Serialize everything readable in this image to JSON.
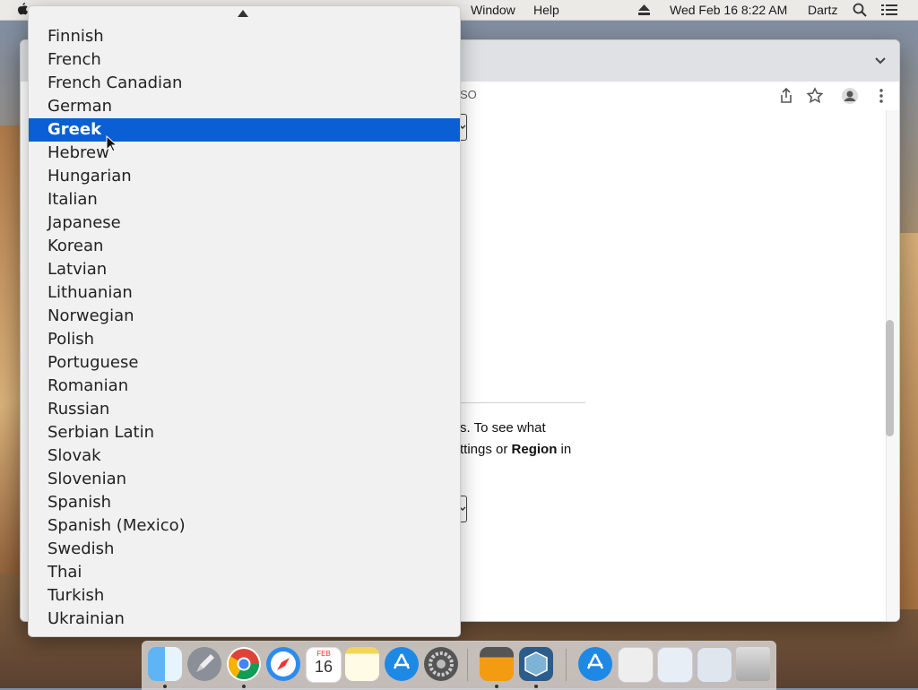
{
  "menubar": {
    "items": [
      "Window",
      "Help"
    ],
    "clock": "Wed Feb 16  8:22 AM",
    "user": "Dartz"
  },
  "browser": {
    "omnibox_fragment": "SO",
    "page_text": {
      "line1": "s. To see what",
      "line2_pre": "ttings or ",
      "line2_bold": "Region",
      "line2_post": " in"
    }
  },
  "dropdown": {
    "options": [
      "Finnish",
      "French",
      "French Canadian",
      "German",
      "Greek",
      "Hebrew",
      "Hungarian",
      "Italian",
      "Japanese",
      "Korean",
      "Latvian",
      "Lithuanian",
      "Norwegian",
      "Polish",
      "Portuguese",
      "Romanian",
      "Russian",
      "Serbian Latin",
      "Slovak",
      "Slovenian",
      "Spanish",
      "Spanish (Mexico)",
      "Swedish",
      "Thai",
      "Turkish",
      "Ukrainian"
    ],
    "selected": "Greek"
  },
  "dock": {
    "calendar_month": "FEB",
    "calendar_day": "16",
    "apps": [
      "finder-icon",
      "launchpad-icon",
      "chrome-icon",
      "safari-icon",
      "calendar-icon",
      "notes-icon",
      "app-store-icon",
      "system-preferences-icon",
      "calculator-icon",
      "virtualbox-icon",
      "app-store-folder-icon",
      "document-icon",
      "downloads-folder-icon",
      "screenshot-icon",
      "trash-icon"
    ]
  },
  "colors": {
    "selection": "#0a5fd4",
    "menubar_bg": "#eceae7",
    "popup_bg": "#f1f1f1"
  }
}
